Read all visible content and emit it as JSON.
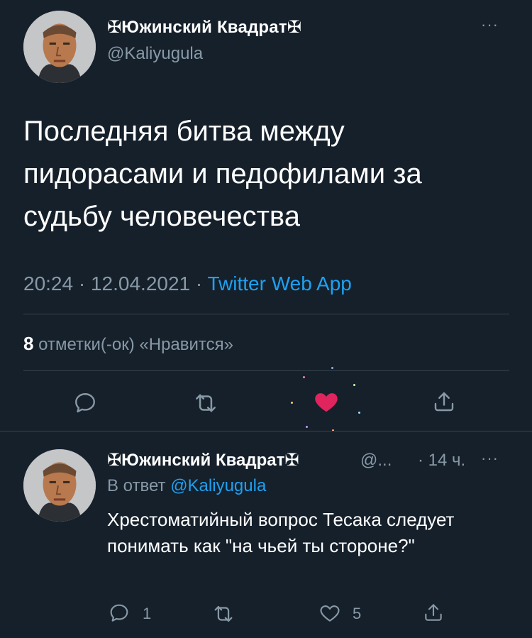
{
  "tweet": {
    "author_name": "✠Южинский Квадрат✠",
    "author_handle": "@Kaliyugula",
    "more_label": "···",
    "text": "Последняя битва между пидорасами и педофилами за судьбу человечества",
    "time": "20:24",
    "date": "12.04.2021",
    "separator": "·",
    "source": "Twitter Web App",
    "likes_count": "8",
    "likes_label": "отметки(-ок) «Нравится»",
    "liked": true
  },
  "reply": {
    "author_name": "✠Южинский Квадрат✠",
    "author_handle": "@...",
    "time_ago": "· 14 ч.",
    "more_label": "···",
    "reply_prefix": "В ответ",
    "reply_to": "@Kaliyugula",
    "text": "Хрестоматийный вопрос Тесака следует понимать как \"на чьей ты стороне?\"",
    "reply_count": "1",
    "like_count": "5"
  },
  "colors": {
    "background": "#15202b",
    "muted": "#8899a6",
    "accent": "#1da1f2",
    "like": "#e0245e",
    "divider": "#38444d"
  },
  "icons": {
    "reply": "reply-icon",
    "retweet": "retweet-icon",
    "like": "heart-icon",
    "share": "share-icon",
    "more": "more-icon"
  }
}
